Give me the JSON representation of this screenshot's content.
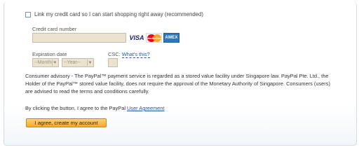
{
  "link_card": {
    "label": "Link my credit card so I can start shopping right away (recommended)",
    "checked": false
  },
  "credit_card": {
    "label": "Credit card number",
    "value": "",
    "logos": [
      "VISA",
      "MasterCard",
      "AMEX"
    ]
  },
  "expiration": {
    "label": "Expiration date",
    "month_selected": "--Month--",
    "year_selected": "--Year--"
  },
  "csc": {
    "label": "CSC",
    "help_link": "What's this?"
  },
  "advisory": {
    "text": "Consumer advisory - The PayPal™ payment service is regarded as a stored value facility under Singapore law. PayPal Pte. Ltd., the Holder of the PayPal™ stored value facility, does not require the approval of the Monetary Authority of Singapore. Consumers (users) are advised to read the terms and conditions carefully."
  },
  "agreement": {
    "prefix": "By clicking the button, I agree to the PayPal ",
    "link": "User Agreement"
  },
  "submit": {
    "label": "I agree, create my account"
  },
  "colors": {
    "input_bg": "#ebe3cf",
    "link": "#1e5a9a",
    "button": "#f4a92b"
  }
}
